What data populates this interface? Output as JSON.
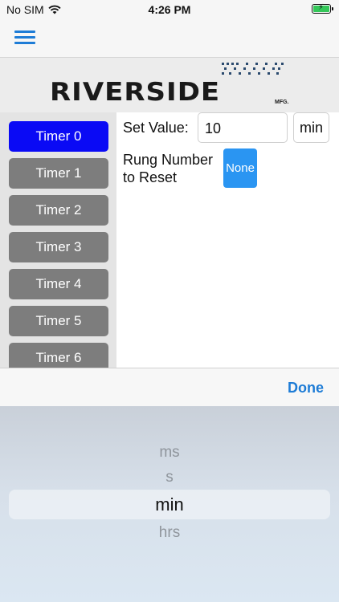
{
  "status_bar": {
    "carrier": "No SIM",
    "time": "4:26 PM",
    "icons": [
      "wifi-icon",
      "battery-charging-icon"
    ]
  },
  "nav": {
    "menu_icon": "hamburger-icon",
    "accent_color": "#1e7cd6"
  },
  "logo": {
    "text": "RIVERSIDE",
    "suffix": "MFG."
  },
  "sidebar": {
    "items": [
      {
        "label": "Timer 0",
        "active": true
      },
      {
        "label": "Timer 1",
        "active": false
      },
      {
        "label": "Timer 2",
        "active": false
      },
      {
        "label": "Timer 3",
        "active": false
      },
      {
        "label": "Timer 4",
        "active": false
      },
      {
        "label": "Timer 5",
        "active": false
      },
      {
        "label": "Timer 6",
        "active": false
      }
    ]
  },
  "form": {
    "set_value_label": "Set Value:",
    "set_value": "10",
    "unit": "min",
    "rung_label": "Rung Number to Reset",
    "rung_button": "None"
  },
  "picker": {
    "done_label": "Done",
    "options": [
      "ms",
      "s",
      "min",
      "hrs"
    ],
    "selected": "min"
  },
  "colors": {
    "active_timer": "#0a0af5",
    "inactive_timer": "#7d7d7d",
    "none_button": "#2a95f2"
  }
}
